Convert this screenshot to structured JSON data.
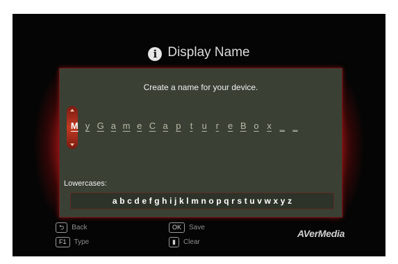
{
  "header": {
    "title": "Display Name",
    "icon": "info-icon"
  },
  "panel": {
    "prompt": "Create a name for your device.",
    "name_chars": [
      "M",
      "y",
      "G",
      "a",
      "m",
      "e",
      "C",
      "a",
      "p",
      "t",
      "u",
      "r",
      "e",
      "B",
      "o",
      "x",
      "_",
      "_"
    ],
    "selected_index": 0,
    "case_label": "Lowercases:",
    "keys": [
      "a",
      "b",
      "c",
      "d",
      "e",
      "f",
      "g",
      "h",
      "i",
      "j",
      "k",
      "l",
      "m",
      "n",
      "o",
      "p",
      "q",
      "r",
      "s",
      "t",
      "u",
      "v",
      "w",
      "x",
      "y",
      "z"
    ]
  },
  "footer": {
    "back": {
      "key": "⮌",
      "label": "Back"
    },
    "type": {
      "key": "F1",
      "label": "Type"
    },
    "save": {
      "key": "OK",
      "label": "Save"
    },
    "clear": {
      "key": "▮",
      "label": "Clear"
    },
    "brand": "AVerMedia"
  },
  "colors": {
    "accent_red": "#c23a22",
    "panel": "#3a4034"
  }
}
